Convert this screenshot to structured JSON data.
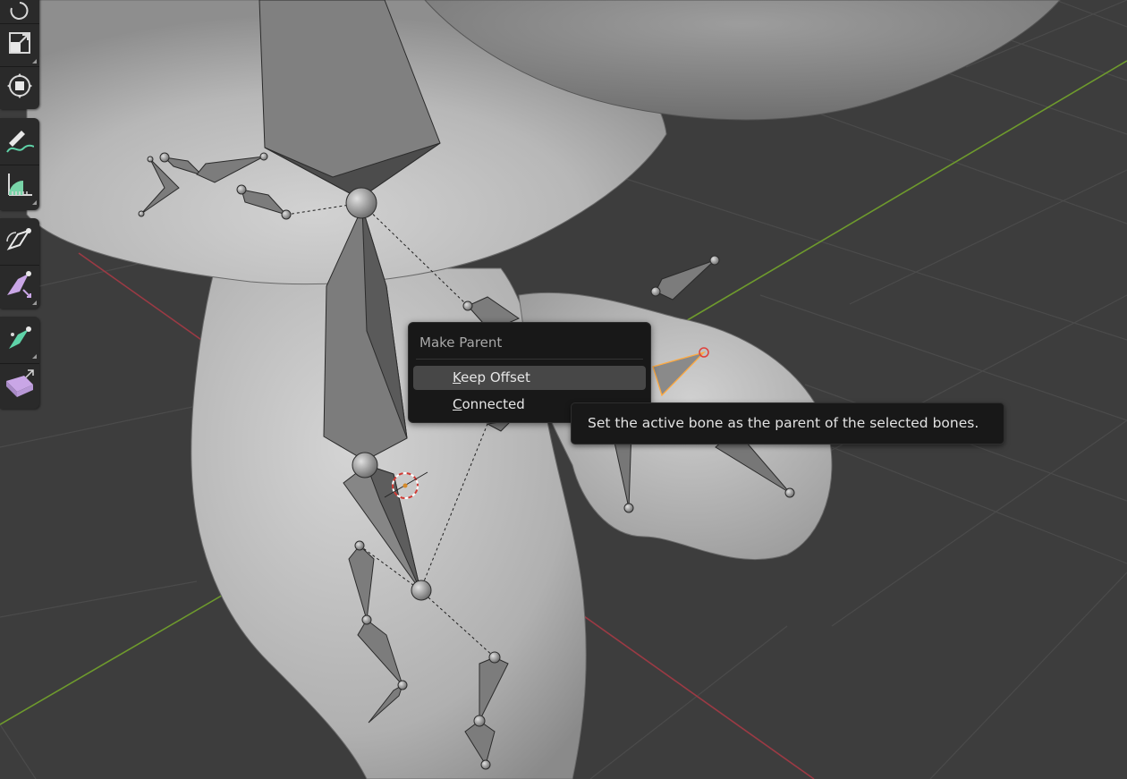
{
  "viewport": {
    "toolbar": {
      "tools": [
        {
          "icon": "rotate-icon"
        },
        {
          "icon": "scale-icon"
        },
        {
          "icon": "transform-icon"
        },
        {
          "icon": "annotate-icon"
        },
        {
          "icon": "measure-icon"
        },
        {
          "icon": "roll-icon"
        },
        {
          "icon": "bone-size-icon"
        },
        {
          "icon": "bone-envelope-icon"
        },
        {
          "icon": "extrude-icon"
        }
      ]
    },
    "colors": {
      "background": "#3d3d3d",
      "grid": "#4a4a4a",
      "x_axis": "#9b3a44",
      "y_axis": "#6e9a2d",
      "mesh": "#b4b4b4",
      "bone": "#777777",
      "active_bone": "#ffaa40"
    }
  },
  "context_menu": {
    "title": "Make Parent",
    "items": [
      {
        "underline": "K",
        "rest": "eep Offset",
        "active": true
      },
      {
        "underline": "C",
        "rest": "onnected",
        "active": false
      }
    ]
  },
  "tooltip": {
    "text": "Set the active bone as the parent of the selected bones."
  }
}
